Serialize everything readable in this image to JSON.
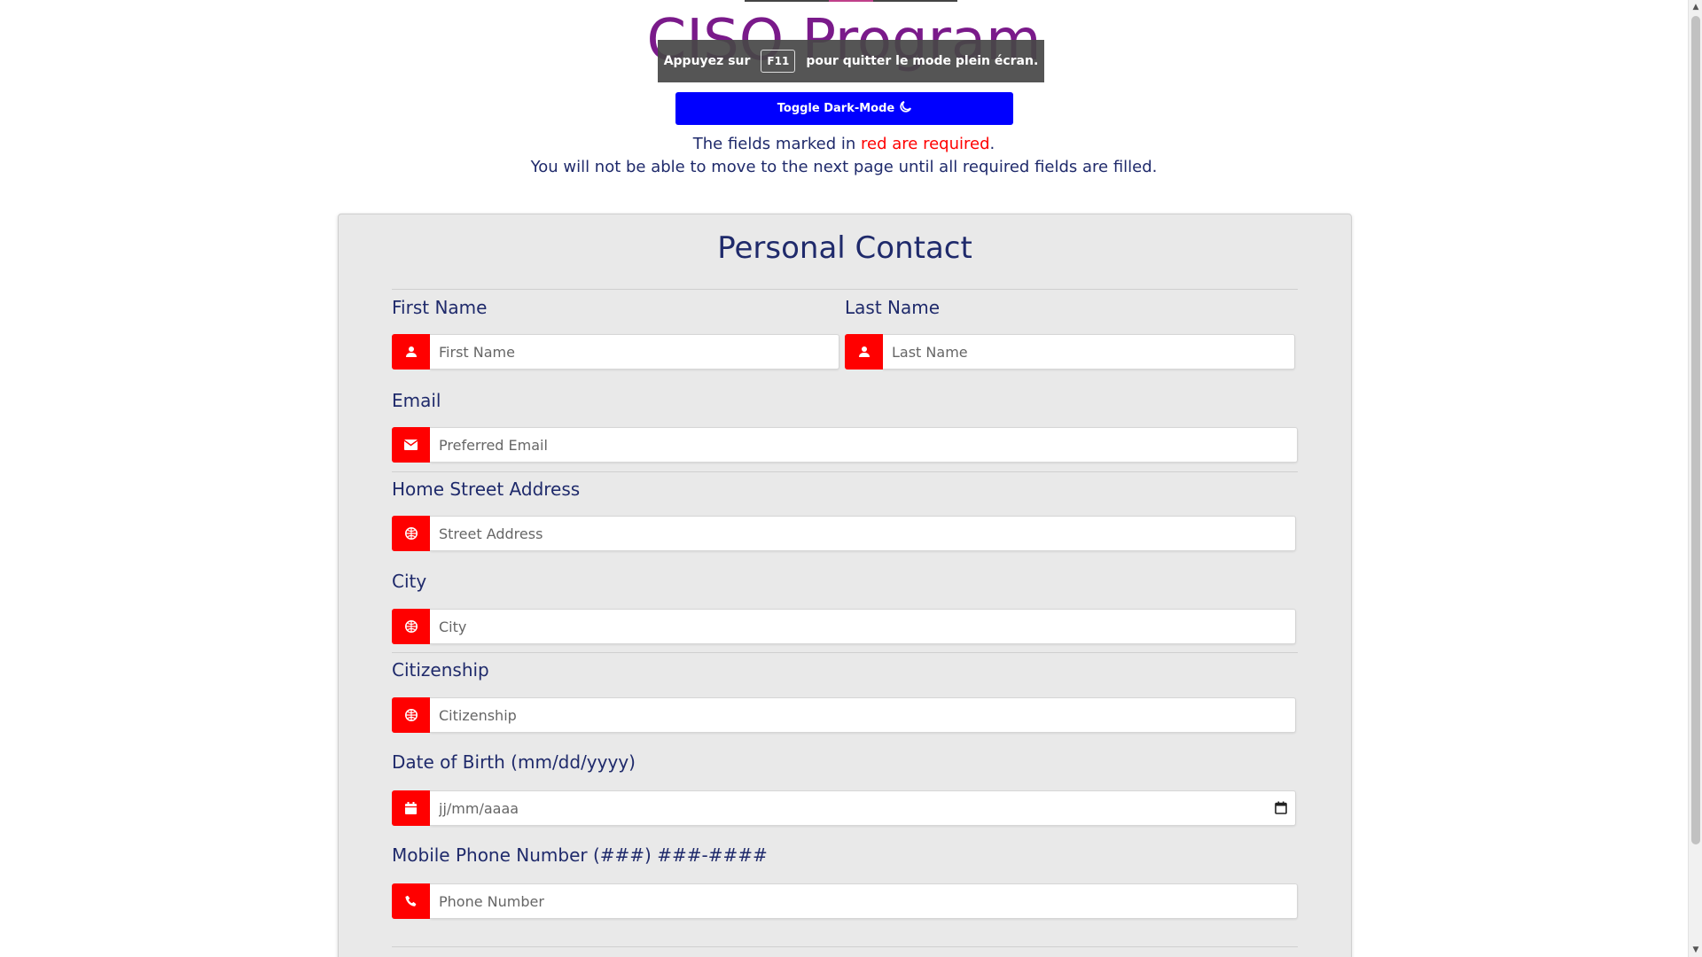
{
  "header": {
    "brand_title": "CISO Program",
    "fullscreen_notice": {
      "before": "Appuyez sur",
      "key": "F11",
      "after": "pour quitter le mode plein écran."
    },
    "toggle_label": "Toggle Dark-Mode",
    "notice_line1_prefix": "The fields marked in ",
    "notice_line1_red": "red are required",
    "notice_line1_suffix": ".",
    "notice_line2": "You will not be able to move to the next page until all required fields are filled."
  },
  "form": {
    "title": "Personal Contact",
    "fields": {
      "first_name": {
        "label": "First Name",
        "placeholder": "First Name",
        "icon": "user-icon"
      },
      "last_name": {
        "label": "Last Name",
        "placeholder": "Last Name",
        "icon": "user-icon"
      },
      "email": {
        "label": "Email",
        "placeholder": "Preferred Email",
        "icon": "envelope-icon"
      },
      "street": {
        "label": "Home Street Address",
        "placeholder": "Street Address",
        "icon": "globe-icon"
      },
      "city": {
        "label": "City",
        "placeholder": "City",
        "icon": "globe-icon"
      },
      "citizenship": {
        "label": "Citizenship",
        "placeholder": "Citizenship",
        "icon": "globe-icon"
      },
      "dob": {
        "label": "Date of Birth (mm/dd/yyyy)",
        "placeholder": "jj/mm/aaaa",
        "icon": "calendar-icon"
      },
      "phone": {
        "label": "Mobile Phone Number (###) ###-####",
        "placeholder": "Phone Number",
        "icon": "phone-icon"
      }
    }
  },
  "colors": {
    "accent_red": "#ff0000",
    "toggle_blue": "#0000ff",
    "text_navy": "#1f2a6b",
    "brand_purple": "#7a1a8a",
    "card_bg": "#e9e9e9"
  }
}
